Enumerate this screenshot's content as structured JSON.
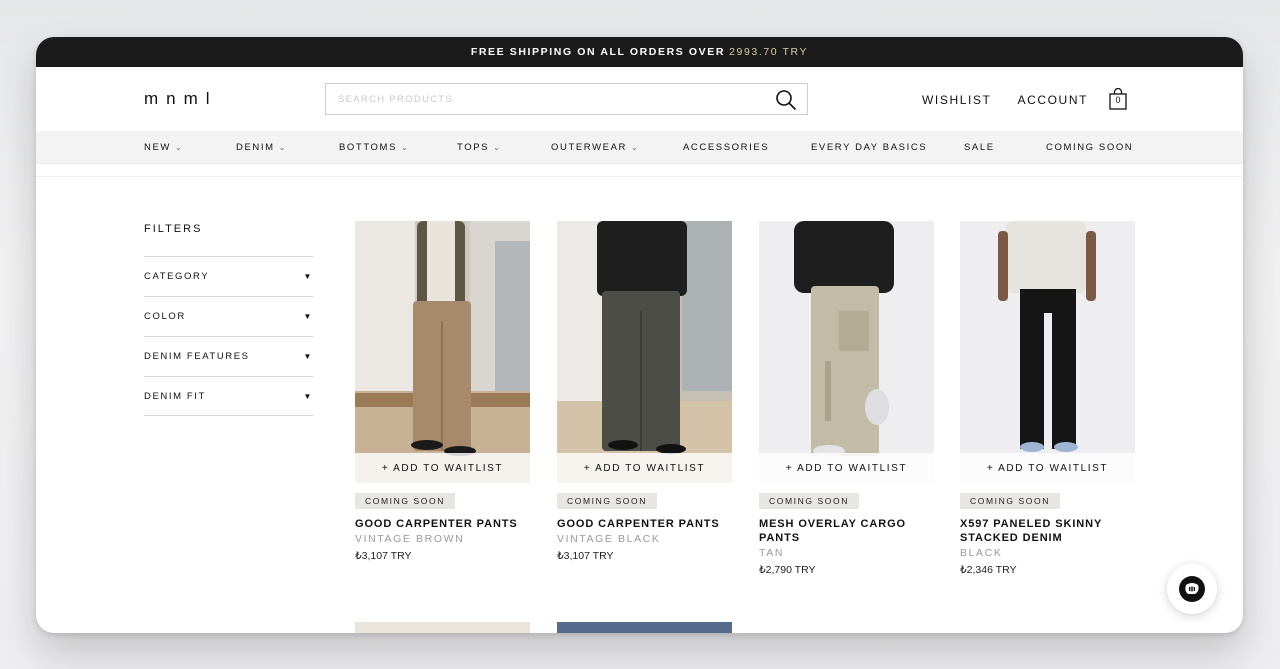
{
  "announcement": {
    "text": "FREE SHIPPING ON ALL ORDERS OVER",
    "amount": "2993.70 TRY"
  },
  "header": {
    "logo": "mnml",
    "search_placeholder": "SEARCH PRODUCTS",
    "wishlist": "WISHLIST",
    "account": "ACCOUNT",
    "cart_count": "0"
  },
  "nav": [
    {
      "label": "NEW",
      "dropdown": true
    },
    {
      "label": "DENIM",
      "dropdown": true
    },
    {
      "label": "BOTTOMS",
      "dropdown": true
    },
    {
      "label": "TOPS",
      "dropdown": true
    },
    {
      "label": "OUTERWEAR",
      "dropdown": true
    },
    {
      "label": "ACCESSORIES",
      "dropdown": false
    },
    {
      "label": "EVERY DAY BASICS",
      "dropdown": false
    },
    {
      "label": "SALE",
      "dropdown": false
    },
    {
      "label": "COMING SOON",
      "dropdown": false
    }
  ],
  "filters": {
    "title": "FILTERS",
    "items": [
      "CATEGORY",
      "COLOR",
      "DENIM FEATURES",
      "DENIM FIT"
    ]
  },
  "products": [
    {
      "badge": "COMING SOON",
      "waitlist": "+ ADD TO WAITLIST",
      "name": "GOOD CARPENTER PANTS",
      "color": "VINTAGE BROWN",
      "price": "₺3,107 TRY"
    },
    {
      "badge": "COMING SOON",
      "waitlist": "+ ADD TO WAITLIST",
      "name": "GOOD CARPENTER PANTS",
      "color": "VINTAGE BLACK",
      "price": "₺3,107 TRY"
    },
    {
      "badge": "COMING SOON",
      "waitlist": "+ ADD TO WAITLIST",
      "name": "MESH OVERLAY CARGO PANTS",
      "color": "TAN",
      "price": "₺2,790 TRY"
    },
    {
      "badge": "COMING SOON",
      "waitlist": "+ ADD TO WAITLIST",
      "name": "X597 PANELED SKINNY STACKED DENIM",
      "color": "BLACK",
      "price": "₺2,346 TRY"
    }
  ],
  "colors": {
    "announcement_bg": "#1b1b1b",
    "announcement_accent": "#d7c9a8",
    "nav_bg": "#f3f3f3",
    "badge_bg": "#e8e6e3",
    "chat_button": "#111111"
  }
}
